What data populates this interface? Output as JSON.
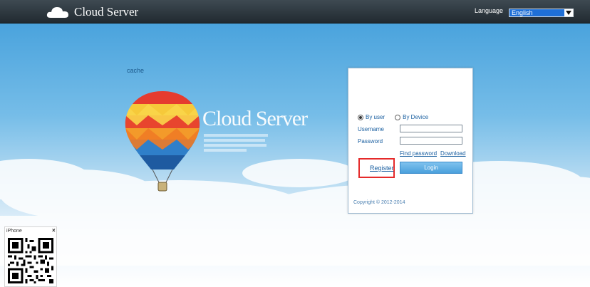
{
  "header": {
    "brand": "Cloud Server",
    "brand_icon": "cloud-logo-icon",
    "language_label": "Language",
    "language_value": "English"
  },
  "hero": {
    "cache_text": "cache",
    "title": "Cloud Server",
    "balloon_icon": "hot-air-balloon-icon"
  },
  "login": {
    "radio_by_user": "By user",
    "radio_by_device": "By Device",
    "selected_mode": "By user",
    "username_label": "Username",
    "password_label": "Password",
    "username_value": "",
    "password_value": "",
    "find_password": "Find password",
    "download": "Download",
    "register": "Register",
    "login_button": "Login",
    "copyright": "Copyright © 2012-2014"
  },
  "qr_widget": {
    "title": "iPhone",
    "close": "×"
  },
  "colors": {
    "topbar": "#2b353b",
    "accent": "#1f6fd6",
    "link": "#1a5fa0",
    "highlight": "#e52a2a",
    "button": "#5aace3"
  }
}
